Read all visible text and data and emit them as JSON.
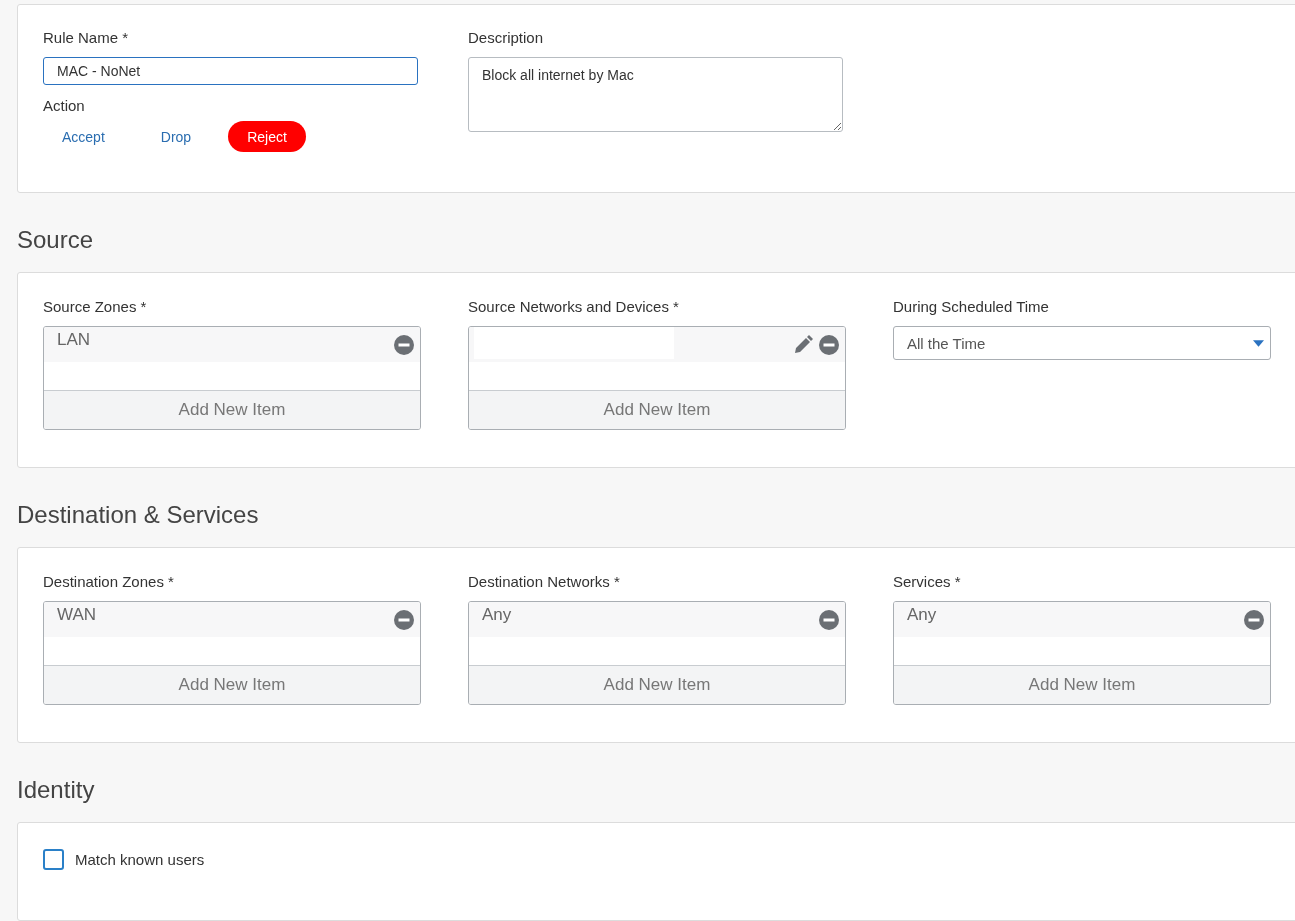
{
  "general": {
    "rule_name": {
      "label": "Rule Name *",
      "value": "MAC - NoNet"
    },
    "description": {
      "label": "Description",
      "value": "Block all internet by Mac"
    },
    "action": {
      "label": "Action",
      "options": [
        {
          "label": "Accept",
          "selected": false
        },
        {
          "label": "Drop",
          "selected": false
        },
        {
          "label": "Reject",
          "selected": true
        }
      ]
    }
  },
  "sections": [
    {
      "title": "Source",
      "fields": [
        {
          "kind": "list",
          "label": "Source Zones *",
          "items": [
            {
              "kind": "text",
              "label": "LAN",
              "editable": false
            }
          ],
          "add_label": "Add New Item"
        },
        {
          "kind": "list",
          "label": "Source Networks and Devices *",
          "items": [
            {
              "kind": "redacted",
              "editable": true
            }
          ],
          "add_label": "Add New Item"
        },
        {
          "kind": "select",
          "label": "During Scheduled Time",
          "value": "All the Time"
        }
      ]
    },
    {
      "title": "Destination & Services",
      "fields": [
        {
          "kind": "list",
          "label": "Destination Zones *",
          "items": [
            {
              "kind": "text",
              "label": "WAN",
              "editable": false
            }
          ],
          "add_label": "Add New Item"
        },
        {
          "kind": "list",
          "label": "Destination Networks *",
          "items": [
            {
              "kind": "text",
              "label": "Any",
              "editable": false
            }
          ],
          "add_label": "Add New Item"
        },
        {
          "kind": "list",
          "label": "Services *",
          "items": [
            {
              "kind": "text",
              "label": "Any",
              "editable": false
            }
          ],
          "add_label": "Add New Item"
        }
      ]
    },
    {
      "title": "Identity",
      "fields": [
        {
          "kind": "checkbox",
          "label": "Match known users",
          "checked": false
        }
      ]
    }
  ]
}
